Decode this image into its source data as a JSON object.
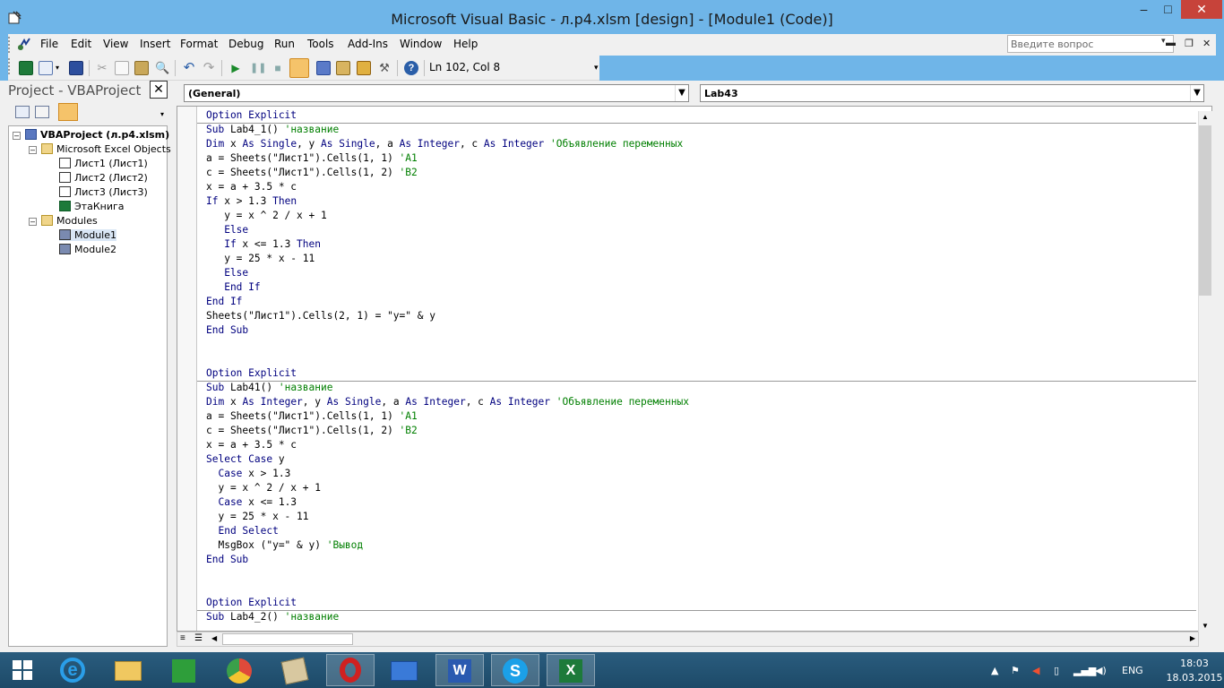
{
  "window": {
    "title": "Microsoft Visual Basic - л.p4.xlsm [design] - [Module1 (Code)]",
    "minimize": "–",
    "maximize": "□",
    "close": "✕"
  },
  "menu": {
    "items": [
      "File",
      "Edit",
      "View",
      "Insert",
      "Format",
      "Debug",
      "Run",
      "Tools",
      "Add-Ins",
      "Window",
      "Help"
    ],
    "ask_placeholder": "Введите вопрос"
  },
  "toolbar": {
    "position_text": "Ln 102, Col 8",
    "icons": [
      "excel-icon",
      "insert-userform-icon",
      "save-icon",
      "cut-icon",
      "copy-icon",
      "paste-icon",
      "find-icon",
      "undo-icon",
      "redo-icon",
      "run-icon",
      "break-icon",
      "reset-icon",
      "design-mode-icon",
      "project-explorer-icon",
      "properties-icon",
      "object-browser-icon",
      "toolbox-icon",
      "help-icon"
    ]
  },
  "project": {
    "title": "Project - VBAProject",
    "close": "✕",
    "tree": {
      "root": "VBAProject (л.p4.xlsm)",
      "excel_objects": "Microsoft Excel Objects",
      "sheet1": "Лист1 (Лист1)",
      "sheet2": "Лист2 (Лист2)",
      "sheet3": "Лист3 (Лист3)",
      "workbook": "ЭтаКнига",
      "modules": "Modules",
      "module1": "Module1",
      "module2": "Module2"
    }
  },
  "combos": {
    "object": "(General)",
    "procedure": "Lab43"
  },
  "code": {
    "lines": [
      [
        [
          "kw",
          "Option Explicit"
        ]
      ],
      [
        [
          "kw",
          "Sub"
        ],
        [
          "t",
          " Lab4_1() "
        ],
        [
          "cm",
          "'название"
        ]
      ],
      [
        [
          "kw",
          "Dim"
        ],
        [
          "t",
          " x "
        ],
        [
          "kw",
          "As Single"
        ],
        [
          "t",
          ", y "
        ],
        [
          "kw",
          "As Single"
        ],
        [
          "t",
          ", a "
        ],
        [
          "kw",
          "As Integer"
        ],
        [
          "t",
          ", c "
        ],
        [
          "kw",
          "As Integer"
        ],
        [
          "t",
          " "
        ],
        [
          "cm",
          "'Объявление переменных"
        ]
      ],
      [
        [
          "t",
          "a = Sheets(\"Лист1\").Cells(1, 1) "
        ],
        [
          "cm",
          "'A1"
        ]
      ],
      [
        [
          "t",
          "c = Sheets(\"Лист1\").Cells(1, 2) "
        ],
        [
          "cm",
          "'B2"
        ]
      ],
      [
        [
          "t",
          "x = a + 3.5 * c"
        ]
      ],
      [
        [
          "kw",
          "If"
        ],
        [
          "t",
          " x > 1.3 "
        ],
        [
          "kw",
          "Then"
        ]
      ],
      [
        [
          "t",
          "   y = x ^ 2 / x + 1"
        ]
      ],
      [
        [
          "kw",
          "   Else"
        ]
      ],
      [
        [
          "kw",
          "   If"
        ],
        [
          "t",
          " x <= 1.3 "
        ],
        [
          "kw",
          "Then"
        ]
      ],
      [
        [
          "t",
          "   y = 25 * x - 11"
        ]
      ],
      [
        [
          "kw",
          "   Else"
        ]
      ],
      [
        [
          "kw",
          "   End If"
        ]
      ],
      [
        [
          "kw",
          "End If"
        ]
      ],
      [
        [
          "t",
          "Sheets(\"Лист1\").Cells(2, 1) = \"y=\" & y"
        ]
      ],
      [
        [
          "kw",
          "End Sub"
        ]
      ],
      [],
      [],
      [
        [
          "kw",
          "Option Explicit"
        ]
      ],
      [
        [
          "kw",
          "Sub"
        ],
        [
          "t",
          " Lab41() "
        ],
        [
          "cm",
          "'название"
        ]
      ],
      [
        [
          "kw",
          "Dim"
        ],
        [
          "t",
          " x "
        ],
        [
          "kw",
          "As Integer"
        ],
        [
          "t",
          ", y "
        ],
        [
          "kw",
          "As Single"
        ],
        [
          "t",
          ", a "
        ],
        [
          "kw",
          "As Integer"
        ],
        [
          "t",
          ", c "
        ],
        [
          "kw",
          "As Integer"
        ],
        [
          "t",
          " "
        ],
        [
          "cm",
          "'Объявление переменных"
        ]
      ],
      [
        [
          "t",
          "a = Sheets(\"Лист1\").Cells(1, 1) "
        ],
        [
          "cm",
          "'A1"
        ]
      ],
      [
        [
          "t",
          "c = Sheets(\"Лист1\").Cells(1, 2) "
        ],
        [
          "cm",
          "'B2"
        ]
      ],
      [
        [
          "t",
          "x = a + 3.5 * c"
        ]
      ],
      [
        [
          "kw",
          "Select Case"
        ],
        [
          "t",
          " y"
        ]
      ],
      [
        [
          "kw",
          "  Case"
        ],
        [
          "t",
          " x > 1.3"
        ]
      ],
      [
        [
          "t",
          "  y = x ^ 2 / x + 1"
        ]
      ],
      [
        [
          "kw",
          "  Case"
        ],
        [
          "t",
          " x <= 1.3"
        ]
      ],
      [
        [
          "t",
          "  y = 25 * x - 11"
        ]
      ],
      [
        [
          "kw",
          "  End Select"
        ]
      ],
      [
        [
          "t",
          "  MsgBox (\"y=\" & y) "
        ],
        [
          "cm",
          "'Вывод"
        ]
      ],
      [
        [
          "kw",
          "End Sub"
        ]
      ],
      [],
      [],
      [
        [
          "kw",
          "Option Explicit"
        ]
      ],
      [
        [
          "kw",
          "Sub"
        ],
        [
          "t",
          " Lab4_2() "
        ],
        [
          "cm",
          "'название"
        ]
      ]
    ]
  },
  "taskbar": {
    "apps": [
      "start-icon",
      "ie-icon",
      "explorer-icon",
      "store-icon",
      "chrome-icon",
      "calc-icon",
      "opera-icon",
      "outlook-icon",
      "word-icon",
      "skype-icon",
      "excel-icon"
    ],
    "language": "ENG",
    "time": "18:03",
    "date": "18.03.2015"
  }
}
